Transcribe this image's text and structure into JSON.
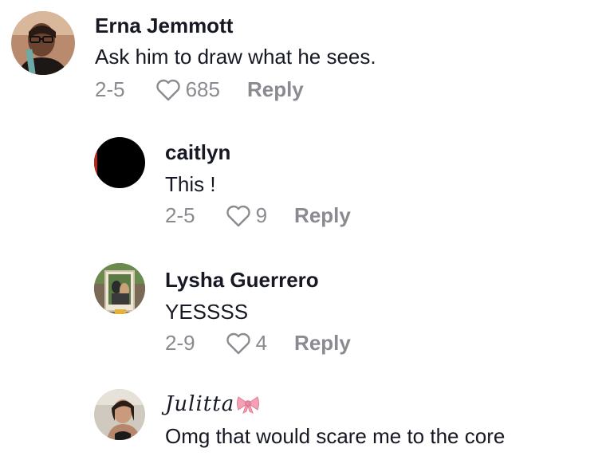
{
  "comments": [
    {
      "username": "Erna Jemmott",
      "text": "Ask him to draw what he sees.",
      "date": "2-5",
      "likes": "685",
      "reply_label": "Reply"
    },
    {
      "username": "caitlyn",
      "text": "This !",
      "date": "2-5",
      "likes": "9",
      "reply_label": "Reply"
    },
    {
      "username": "Lysha Guerrero",
      "text": "YESSSS",
      "date": "2-9",
      "likes": "4",
      "reply_label": "Reply"
    },
    {
      "username": "Julitta",
      "username_emoji": "ribbon-emoji",
      "text": "Omg that would scare me to the core"
    }
  ],
  "colors": {
    "text": "#161823",
    "meta": "#8a8b91",
    "ribbon": "#f4a0b5"
  }
}
